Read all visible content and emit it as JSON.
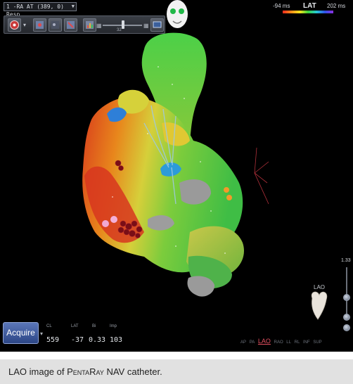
{
  "map": {
    "selected": "1 -RA AT (389, 0) Resp"
  },
  "toolbar": {
    "slider_value": "32"
  },
  "scale": {
    "title": "LAT",
    "min": "-94 ms",
    "max": "202 ms",
    "colors": [
      "#ff2a1e",
      "#ff8c1a",
      "#ffe31a",
      "#3ad13a",
      "#25c9d4",
      "#2e52e8",
      "#8b2fe0"
    ]
  },
  "acquire": {
    "label": "Acquire"
  },
  "metrics": [
    {
      "label": "CL",
      "value": "559"
    },
    {
      "label": "LAT",
      "value": "-37"
    },
    {
      "label": "Bi",
      "value": "0.33"
    },
    {
      "label": "Imp",
      "value": "103"
    }
  ],
  "views": [
    "AP",
    "PA",
    "LAO",
    "RAO",
    "LL",
    "RL",
    "INF",
    "SUP"
  ],
  "active_view": "LAO",
  "zoom": {
    "value": "1.33"
  },
  "orientation": {
    "label": "LAO"
  },
  "caption": {
    "prefix": "LAO image of ",
    "catheter": "PentaRay",
    "suffix": " NAV catheter."
  }
}
